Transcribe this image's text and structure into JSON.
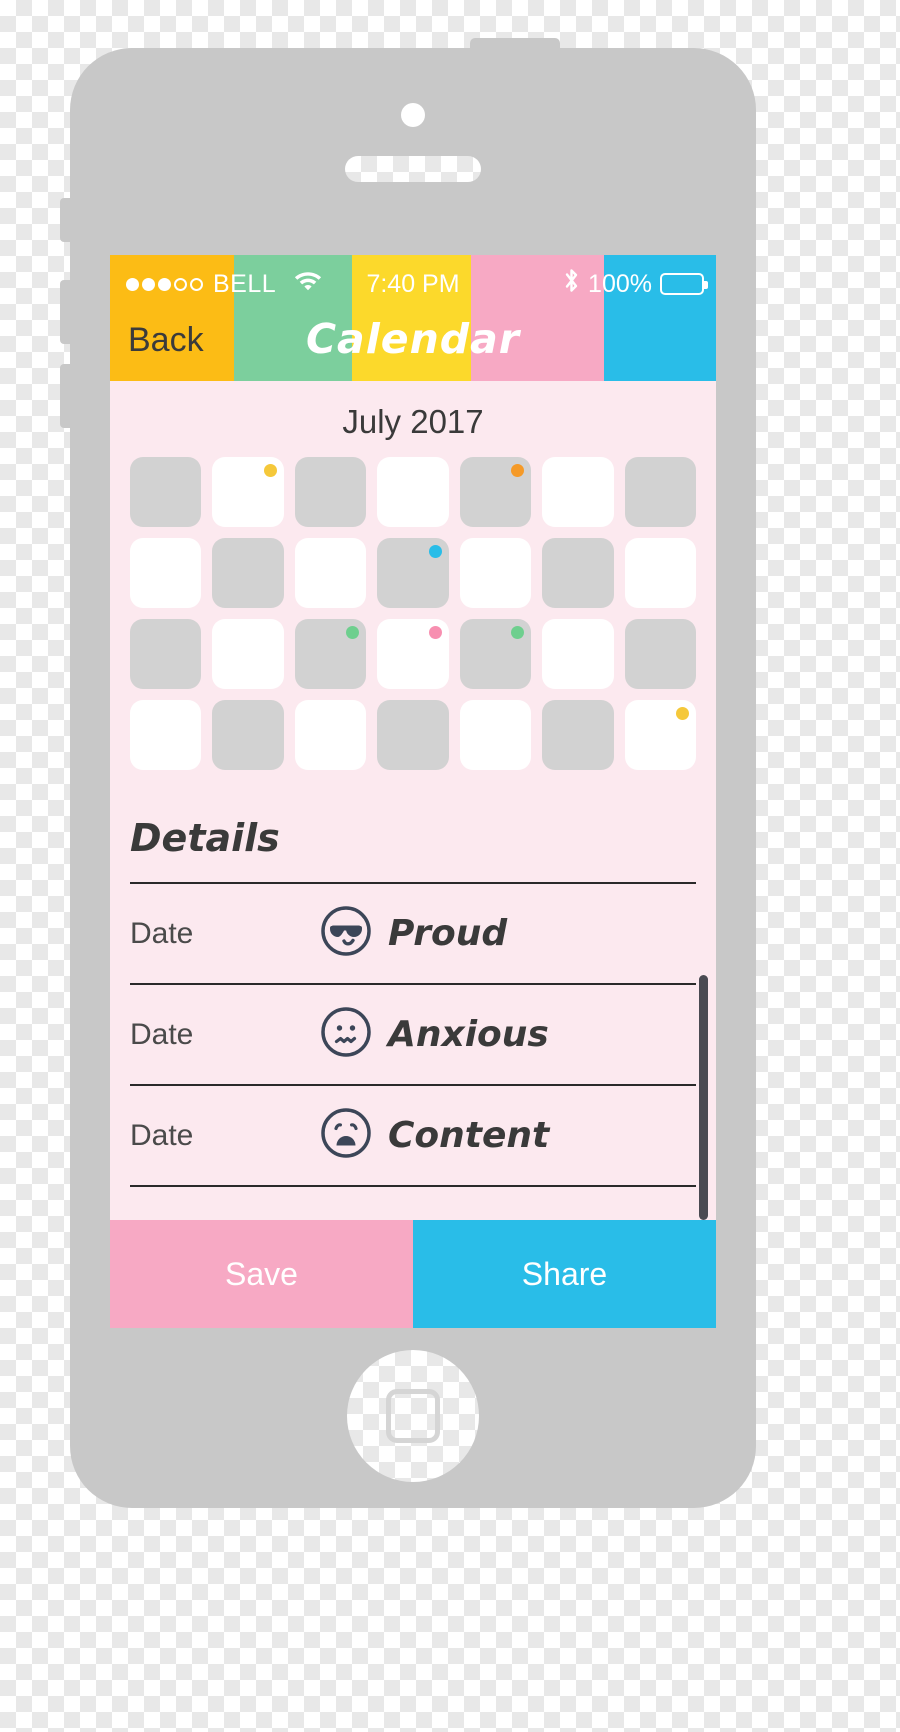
{
  "status_bar": {
    "signal_dots_filled": 3,
    "signal_dots_total": 5,
    "carrier": "BELL",
    "wifi_icon": "wifi-icon",
    "time": "7:40 PM",
    "bluetooth_icon": "bluetooth-icon",
    "battery_percent": "100%",
    "battery_icon": "battery-full-icon",
    "strip_colors": [
      "#fcbc15",
      "#7ccf9d",
      "#fcd92b",
      "#f7a9c4",
      "#29bde8"
    ]
  },
  "nav": {
    "back_label": "Back",
    "title": "Calendar"
  },
  "calendar": {
    "month_title": "July 2017",
    "rows": [
      [
        {
          "shaded": true,
          "dot": null
        },
        {
          "shaded": false,
          "dot": "#f5c83a"
        },
        {
          "shaded": true,
          "dot": null
        },
        {
          "shaded": false,
          "dot": null
        },
        {
          "shaded": true,
          "dot": "#f59a28"
        },
        {
          "shaded": false,
          "dot": null
        },
        {
          "shaded": true,
          "dot": null
        }
      ],
      [
        {
          "shaded": false,
          "dot": null
        },
        {
          "shaded": true,
          "dot": null
        },
        {
          "shaded": false,
          "dot": null
        },
        {
          "shaded": true,
          "dot": "#29bde8"
        },
        {
          "shaded": false,
          "dot": null
        },
        {
          "shaded": true,
          "dot": null
        },
        {
          "shaded": false,
          "dot": null
        }
      ],
      [
        {
          "shaded": true,
          "dot": null
        },
        {
          "shaded": false,
          "dot": null
        },
        {
          "shaded": true,
          "dot": "#6ecf8e"
        },
        {
          "shaded": false,
          "dot": "#f78fb0"
        },
        {
          "shaded": true,
          "dot": "#6ecf8e"
        },
        {
          "shaded": false,
          "dot": null
        },
        {
          "shaded": true,
          "dot": null
        }
      ],
      [
        {
          "shaded": false,
          "dot": null
        },
        {
          "shaded": true,
          "dot": null
        },
        {
          "shaded": false,
          "dot": null
        },
        {
          "shaded": true,
          "dot": null
        },
        {
          "shaded": false,
          "dot": null
        },
        {
          "shaded": true,
          "dot": null
        },
        {
          "shaded": false,
          "dot": "#f5c83a"
        }
      ]
    ]
  },
  "details": {
    "heading": "Details",
    "rows": [
      {
        "date_label": "Date",
        "mood": "Proud",
        "icon": "sunglasses-face-icon"
      },
      {
        "date_label": "Date",
        "mood": "Anxious",
        "icon": "worried-face-icon"
      },
      {
        "date_label": "Date",
        "mood": "Content",
        "icon": "open-mouth-face-icon"
      }
    ]
  },
  "footer": {
    "save_label": "Save",
    "share_label": "Share",
    "save_color": "#f7a9c4",
    "share_color": "#29bde8"
  }
}
